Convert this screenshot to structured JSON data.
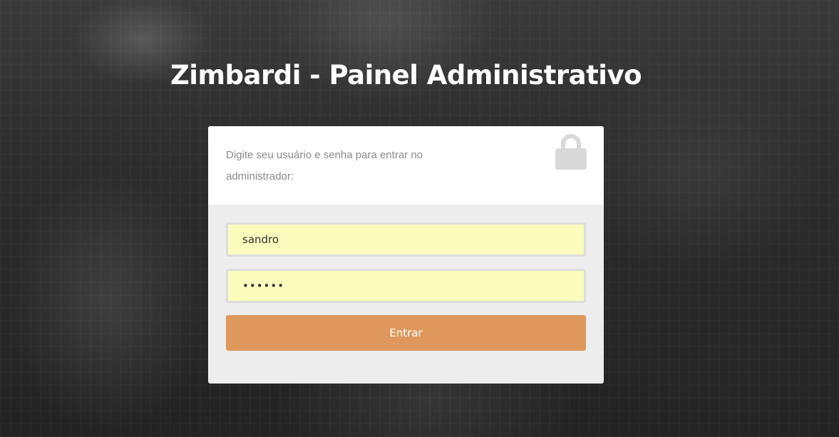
{
  "page": {
    "title": "Zimbardi - Painel Administrativo"
  },
  "login": {
    "description": "Digite seu usuário e senha para entrar no administrador:",
    "lock_icon": "lock-icon",
    "username_value": "sandro",
    "password_value": "••••••",
    "submit_label": "Entrar"
  },
  "colors": {
    "accent": "#de985c",
    "field_bg": "#fafcbe",
    "card_body_bg": "#ededed",
    "lock_gray": "#d9d9d9"
  }
}
